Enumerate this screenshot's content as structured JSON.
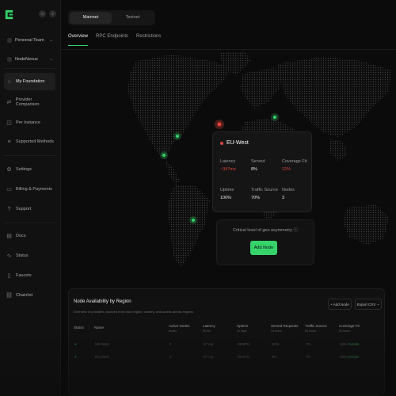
{
  "sidebar": {
    "team_select": "Personal Team",
    "project_select": "NodeNexus",
    "items_a": [
      {
        "label": "My Foundation",
        "icon": "home-icon"
      },
      {
        "label": "Provider Comparison",
        "icon": "compare-icon"
      },
      {
        "label": "Per Instance",
        "icon": "cube-icon"
      },
      {
        "label": "Supported Methods",
        "icon": "list-icon"
      }
    ],
    "items_b": [
      {
        "label": "Settings",
        "icon": "gear-icon"
      },
      {
        "label": "Billing & Payments",
        "icon": "card-icon"
      },
      {
        "label": "Support",
        "icon": "help-icon"
      }
    ],
    "items_c": [
      {
        "label": "Docs",
        "icon": "doc-icon"
      },
      {
        "label": "Status",
        "icon": "pulse-icon"
      },
      {
        "label": "Faucets",
        "icon": "faucet-icon"
      },
      {
        "label": "Chainlist",
        "icon": "link-icon"
      }
    ]
  },
  "network": {
    "mainnet": "Mainnet",
    "testnet": "Testnet"
  },
  "tabs": [
    "Overview",
    "RPC Endpoints",
    "Restrictions"
  ],
  "popup": {
    "region": "EU-West",
    "latency_label": "Latency",
    "latency_value": "~347ms",
    "served_label": "Served",
    "served_value": "8%",
    "coverage_label": "Coverage Fit",
    "coverage_value": "12%",
    "uptime_label": "Uptime",
    "uptime_value": "100%",
    "traffic_label": "Traffic Source",
    "traffic_value": "70%",
    "nodes_label": "Nodes",
    "nodes_value": "3"
  },
  "asymmetry": {
    "text": "Critical level of geo asymmetry",
    "button": "Add Node"
  },
  "panel": {
    "title": "Node Availability by Region",
    "subtitle": "Overview of providers, sourced from each region, country, and access across regions",
    "add_node": "+ Add Node",
    "export": "Export CSV",
    "columns": [
      {
        "label": "Status",
        "unit": ""
      },
      {
        "label": "Name",
        "unit": ""
      },
      {
        "label": "Active Nodes",
        "unit": "Nodes"
      },
      {
        "label": "Latency",
        "unit": "95 ms"
      },
      {
        "label": "Uptime",
        "unit": "30 days"
      },
      {
        "label": "Served Requests",
        "unit": "24 hours"
      },
      {
        "label": "Traffic Source",
        "unit": "24 hours"
      },
      {
        "label": "Coverage Fit",
        "unit": "24 hours"
      }
    ],
    "rows": [
      {
        "status": "●",
        "name": "US-West",
        "nodes": "4",
        "latency": "67 ms",
        "uptime": "99.97%",
        "served": "31%",
        "traffic": "7%",
        "coverage": "62%",
        "action": "Details"
      },
      {
        "status": "●",
        "name": "EU-West",
        "nodes": "3",
        "latency": "67 ms",
        "uptime": "99.97%",
        "served": "8%",
        "traffic": "7%",
        "coverage": "62%",
        "action": "Details"
      }
    ]
  },
  "colors": {
    "accent": "#35d36a",
    "alert": "#e0443e",
    "bg": "#0b0b0b"
  }
}
